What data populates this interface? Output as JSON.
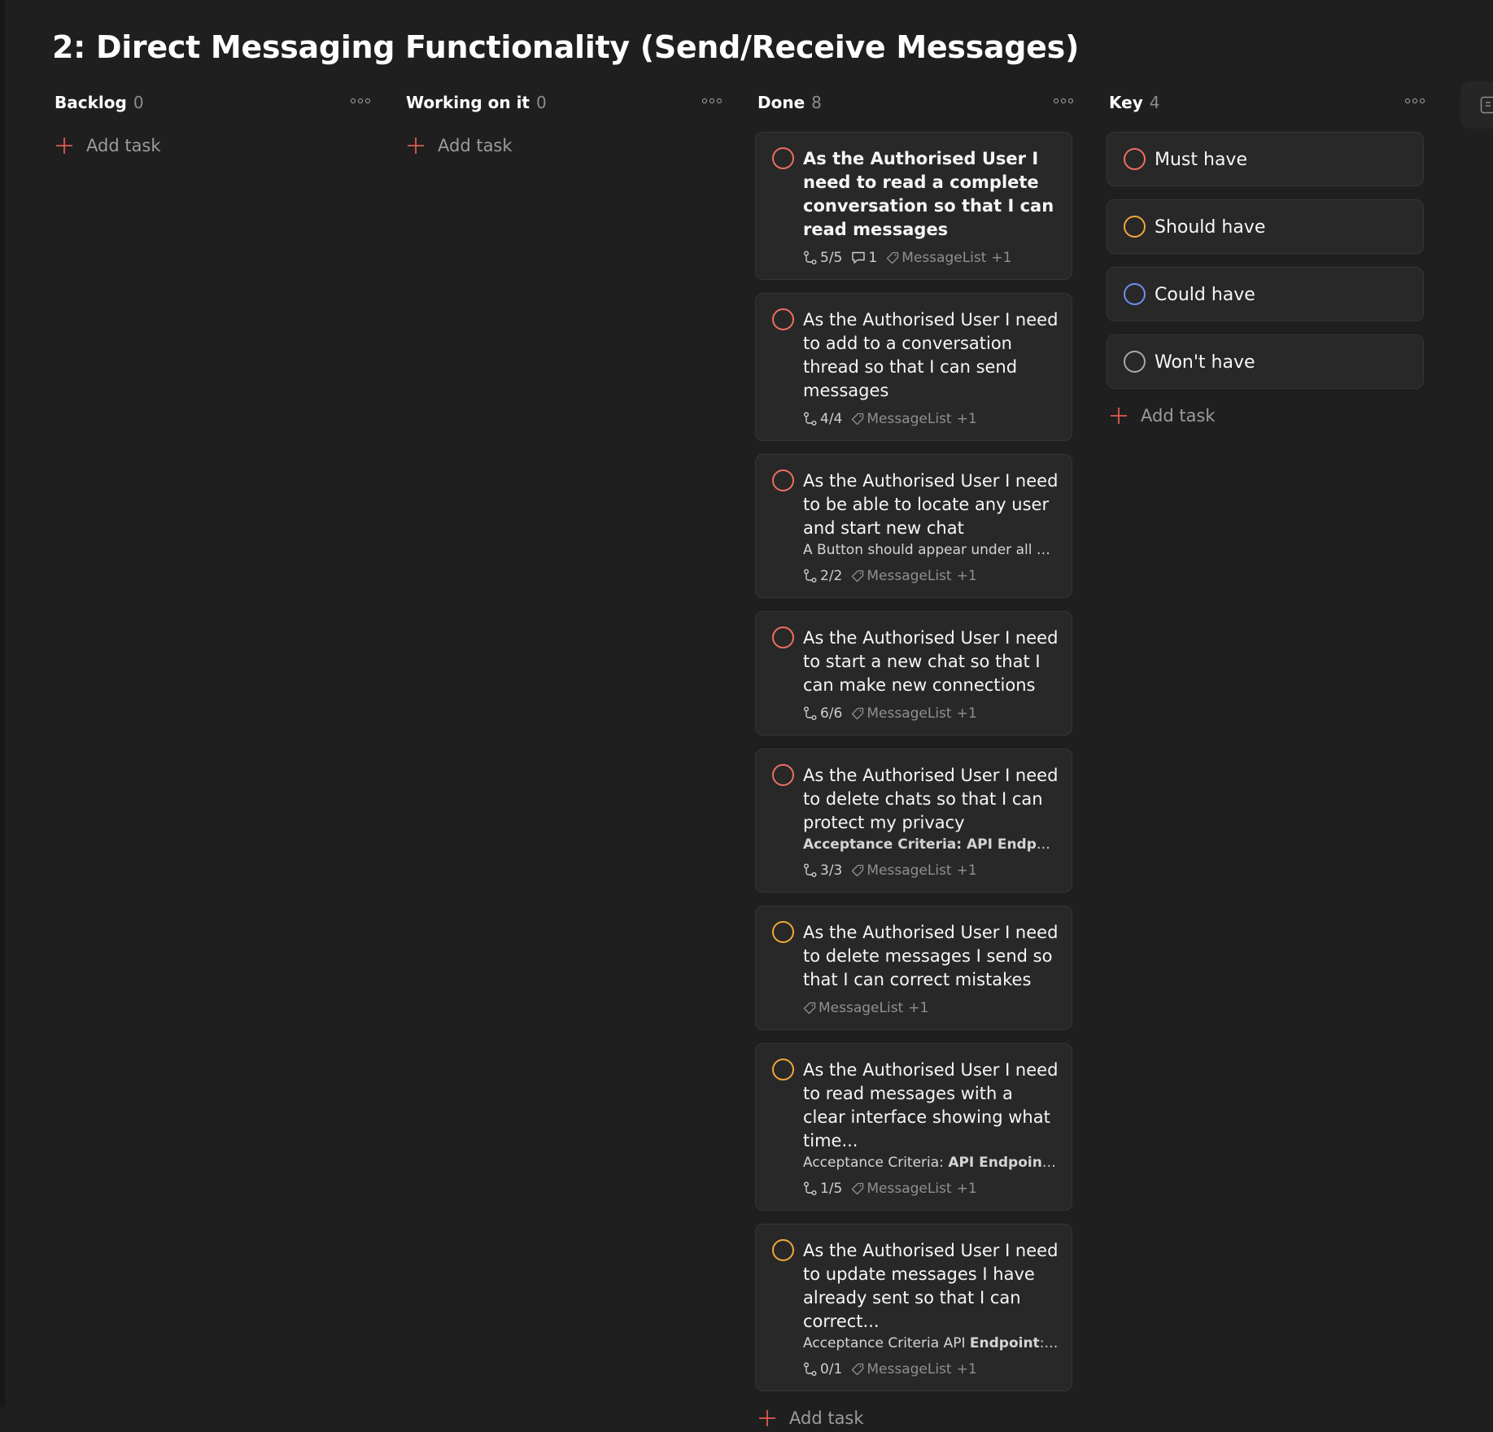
{
  "page": {
    "title": "2: Direct Messaging Functionality (Send/Receive Messages)"
  },
  "colors": {
    "must": "#ee6f61",
    "should": "#f2a73b",
    "could": "#6e8ef2",
    "wont": "#a8a8a8",
    "accent": "#e05a4d"
  },
  "columns": [
    {
      "name": "Backlog",
      "count": "0",
      "add_label": "Add task",
      "cards": []
    },
    {
      "name": "Working on it",
      "count": "0",
      "add_label": "Add task",
      "cards": []
    },
    {
      "name": "Done",
      "count": "8",
      "add_label": "Add task",
      "cards": [
        {
          "title": "As the Authorised User I need to read a complete conversation so that I can read messages",
          "title_bold": true,
          "priority": "must",
          "subtasks": "5/5",
          "comments": "1",
          "label": "MessageList",
          "label_more": "+1"
        },
        {
          "title": "As the Authorised User I need to add to a conversation thread so that I can send messages",
          "priority": "must",
          "subtasks": "4/4",
          "label": "MessageList",
          "label_more": "+1"
        },
        {
          "title": "As the Authorised User I need to be able to locate any user and start new chat",
          "priority": "must",
          "desc": "A Button should appear under all use...",
          "subtasks": "2/2",
          "label": "MessageList",
          "label_more": "+1"
        },
        {
          "title": "As the Authorised User I need to start a new chat so that I can make new connections",
          "priority": "must",
          "subtasks": "6/6",
          "label": "MessageList",
          "label_more": "+1"
        },
        {
          "title": "As the Authorised User I need to delete chats so that I can protect my privacy",
          "priority": "must",
          "desc_bold": "Acceptance Criteria: API Endpoint fo...",
          "subtasks": "3/3",
          "label": "MessageList",
          "label_more": "+1"
        },
        {
          "title": "As the Authorised User I need to delete messages I send so that I can correct mistakes",
          "priority": "should",
          "label": "MessageList",
          "label_more": "+1"
        },
        {
          "title": "As the Authorised User I need to read messages with a clear interface showing what time...",
          "priority": "should",
          "desc": "Acceptance Criteria: ",
          "desc_bold": "API Endpoint fo...",
          "subtasks": "1/5",
          "label": "MessageList",
          "label_more": "+1"
        },
        {
          "title": "As the Authorised User I need to update messages I have already sent so that I can correct...",
          "priority": "should",
          "desc": "Acceptance Criteria API ",
          "desc_bold": "Endpoint",
          "desc_after": ": Ad...",
          "subtasks": "0/1",
          "label": "MessageList",
          "label_more": "+1"
        }
      ]
    },
    {
      "name": "Key",
      "count": "4",
      "add_label": "Add task",
      "cards": [
        {
          "title": "Must have",
          "priority": "must"
        },
        {
          "title": "Should have",
          "priority": "should"
        },
        {
          "title": "Could have",
          "priority": "could"
        },
        {
          "title": "Won't have",
          "priority": "wont"
        }
      ]
    }
  ]
}
